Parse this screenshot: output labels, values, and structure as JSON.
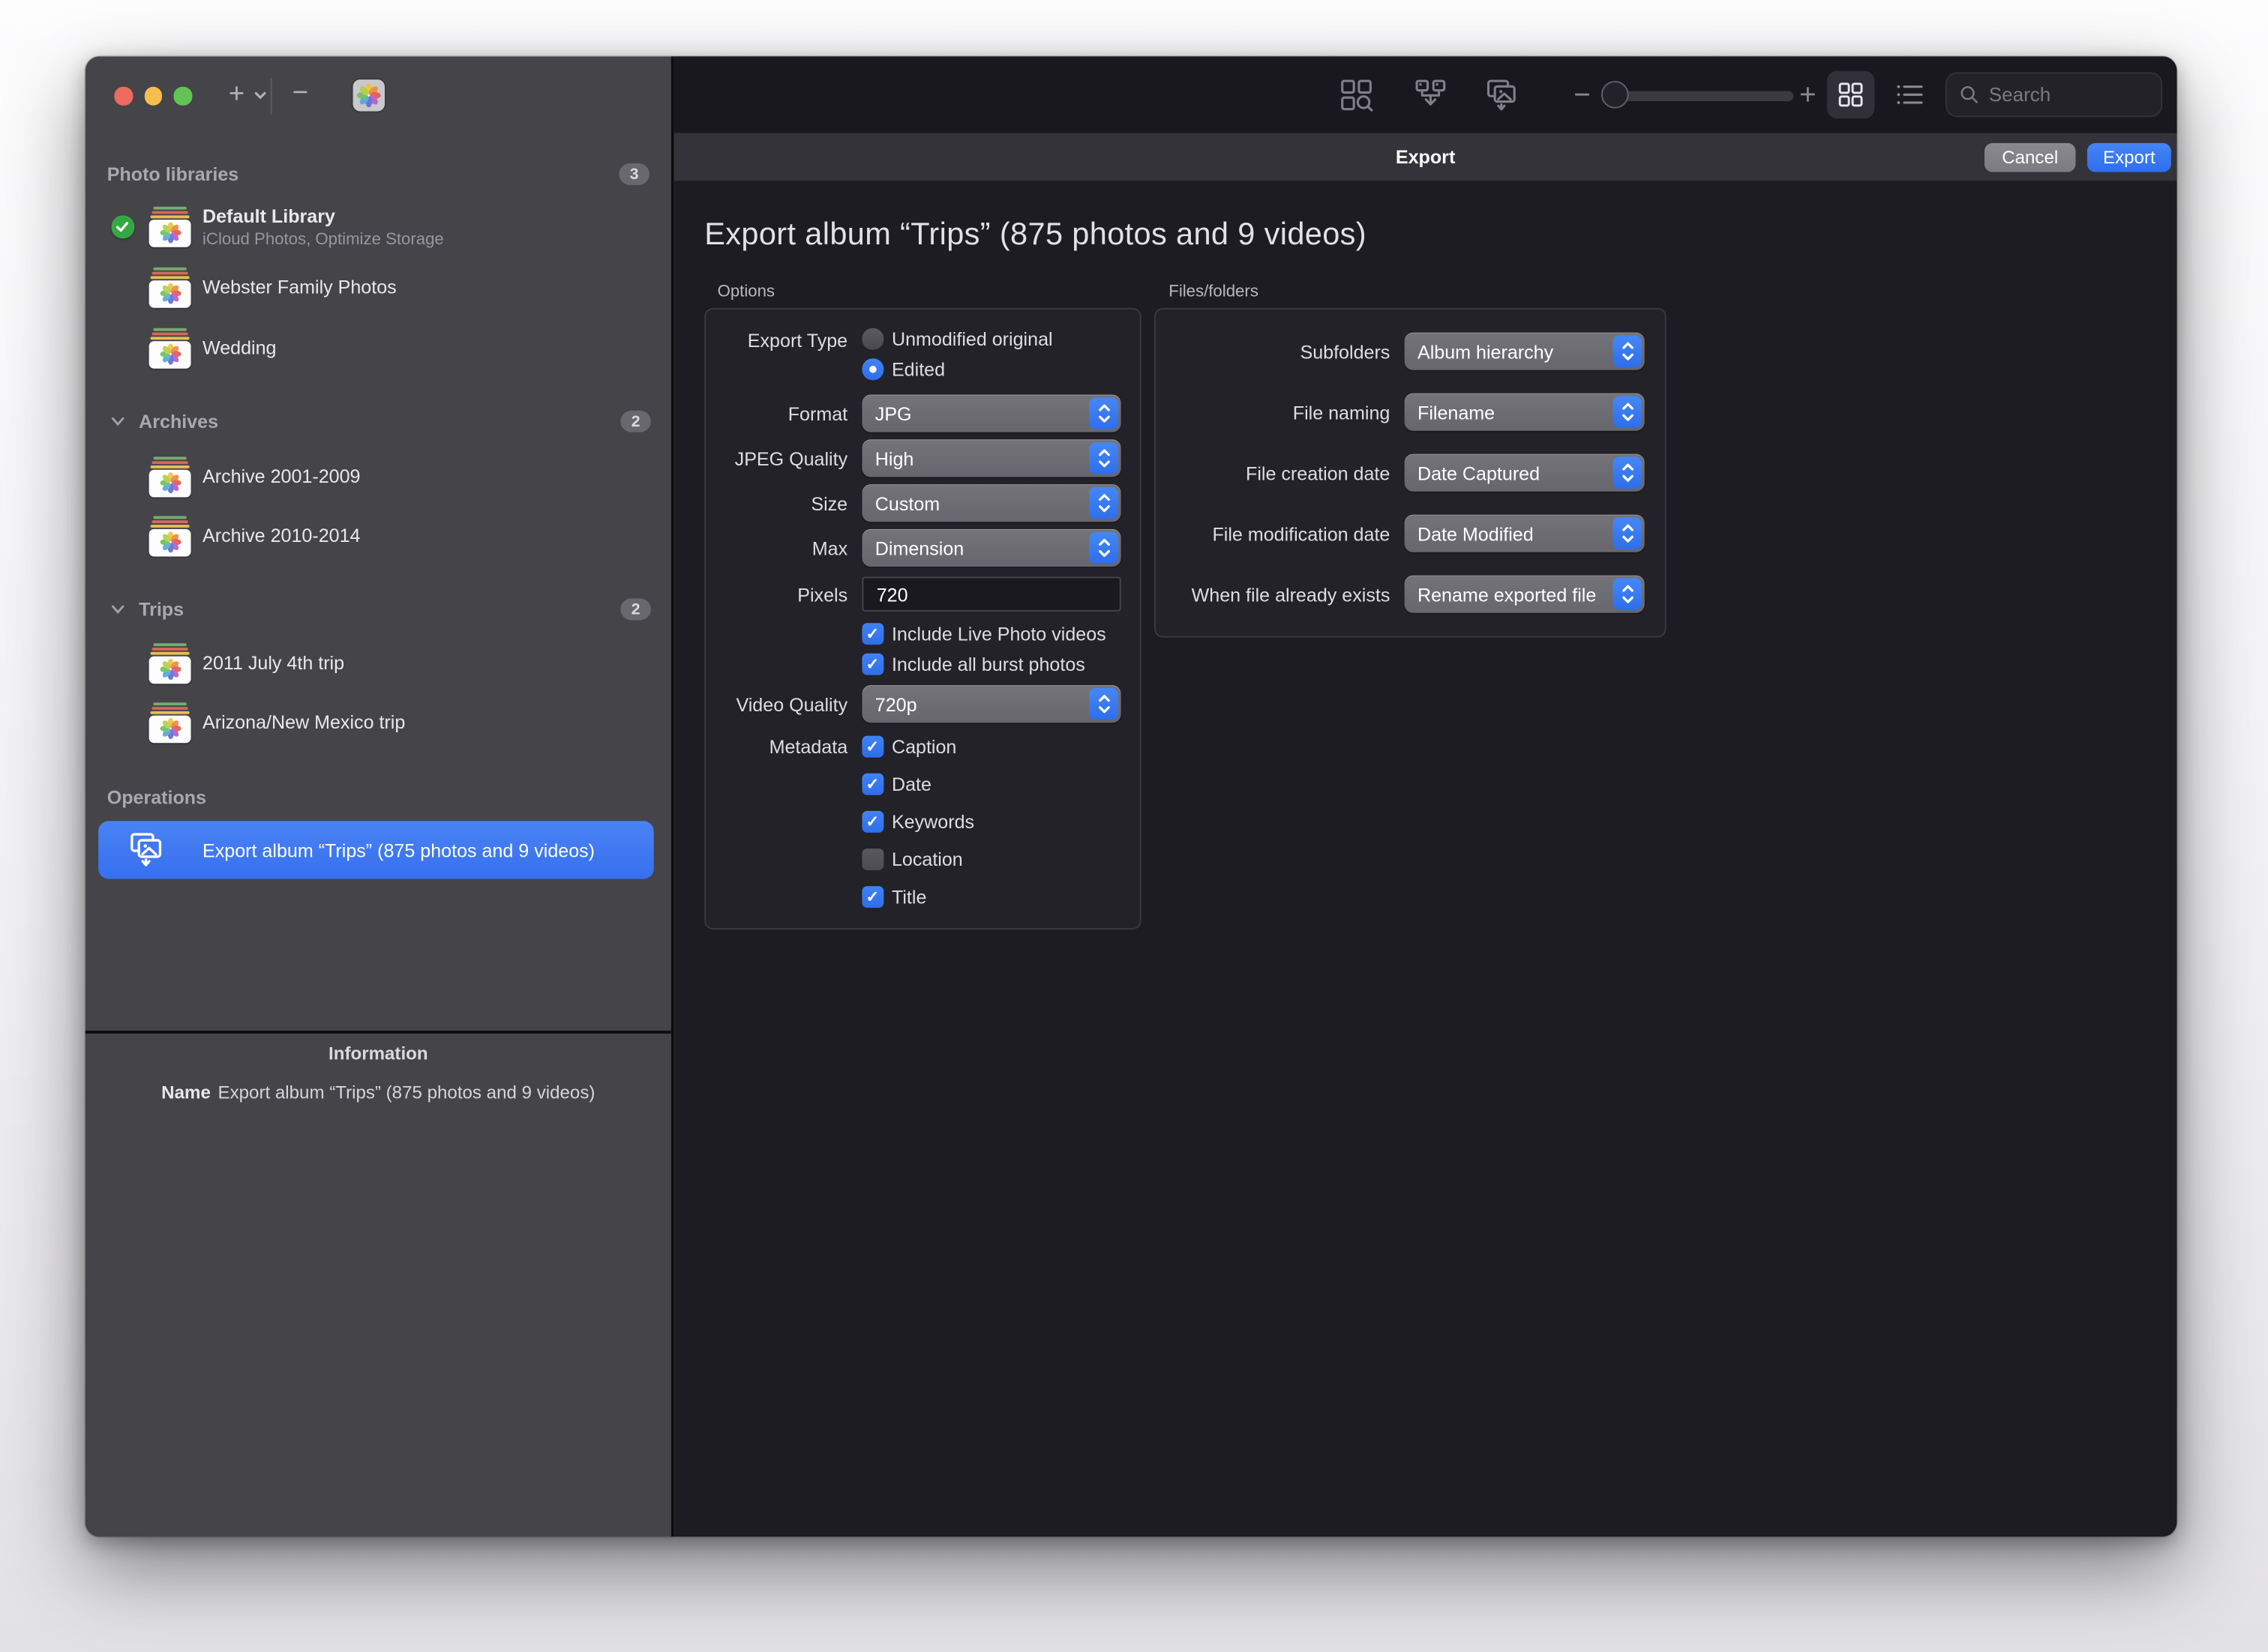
{
  "titlebar": {
    "add_label": "+",
    "remove_label": "−"
  },
  "sidebar": {
    "sections": [
      {
        "label": "Photo libraries",
        "badge": "3",
        "items": [
          {
            "name": "Default Library",
            "subtitle": "iCloud Photos, Optimize Storage"
          },
          {
            "name": "Webster Family Photos"
          },
          {
            "name": "Wedding"
          }
        ]
      },
      {
        "label": "Archives",
        "badge": "2",
        "items": [
          {
            "name": "Archive 2001-2009"
          },
          {
            "name": "Archive 2010-2014"
          }
        ]
      },
      {
        "label": "Trips",
        "badge": "2",
        "items": [
          {
            "name": "2011 July 4th trip"
          },
          {
            "name": "Arizona/New Mexico trip"
          }
        ]
      }
    ],
    "operations": {
      "label": "Operations",
      "selected_item": "Export album “Trips” (875 photos and 9 videos)"
    },
    "information": {
      "title": "Information",
      "name_label": "Name",
      "name_value": "Export album “Trips” (875 photos and 9 videos)"
    }
  },
  "toolbar": {
    "search_placeholder": "Search"
  },
  "export_bar": {
    "title": "Export",
    "cancel_label": "Cancel",
    "export_label": "Export"
  },
  "main": {
    "title": "Export album “Trips” (875 photos and 9 videos)",
    "options": {
      "label": "Options",
      "export_type_label": "Export Type",
      "radio_unmodified": "Unmodified original",
      "radio_edited": "Edited",
      "rows": [
        {
          "label": "Format",
          "value": "JPG"
        },
        {
          "label": "JPEG Quality",
          "value": "High"
        },
        {
          "label": "Size",
          "value": "Custom"
        },
        {
          "label": "Max",
          "value": "Dimension"
        }
      ],
      "pixels_label": "Pixels",
      "pixels_value": "720",
      "checkboxes": [
        {
          "label": "Include Live Photo videos",
          "checked": true
        },
        {
          "label": "Include all burst photos",
          "checked": true
        }
      ],
      "video_quality_label": "Video Quality",
      "video_quality_value": "720p",
      "metadata_label": "Metadata",
      "metadata": [
        {
          "label": "Caption",
          "checked": true
        },
        {
          "label": "Date",
          "checked": true
        },
        {
          "label": "Keywords",
          "checked": true
        },
        {
          "label": "Location",
          "checked": false
        },
        {
          "label": "Title",
          "checked": true
        }
      ]
    },
    "files": {
      "label": "Files/folders",
      "rows": [
        {
          "label": "Subfolders",
          "value": "Album hierarchy"
        },
        {
          "label": "File naming",
          "value": "Filename"
        },
        {
          "label": "File creation date",
          "value": "Date Captured"
        },
        {
          "label": "File modification date",
          "value": "Date Modified"
        },
        {
          "label": "When file already exists",
          "value": "Rename exported file"
        }
      ]
    }
  },
  "colors": {
    "accent": "#3b76f2",
    "selection": "#3b74f0",
    "sidebar_bg": "#454449",
    "toolbar_bg": "#19181e",
    "content_bg": "#1d1c22",
    "export_bar_bg": "#343339",
    "traffic_red": "#ed6a5e",
    "traffic_yellow": "#f5bf4f",
    "traffic_green": "#61c454"
  }
}
